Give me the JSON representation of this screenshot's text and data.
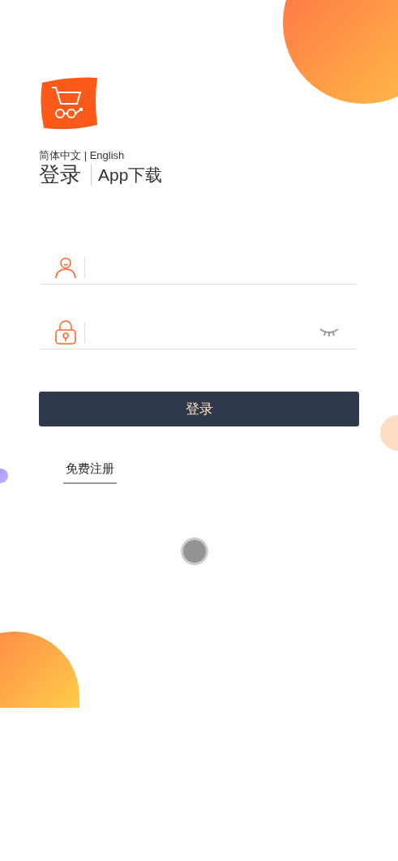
{
  "language_switch": {
    "options": [
      "简体中文",
      "English"
    ],
    "separator": "|"
  },
  "header": {
    "title": "登录",
    "download_link": "App下载"
  },
  "fields": [
    {
      "kind": "username"
    },
    {
      "kind": "password"
    }
  ],
  "login_button": "登录",
  "register_link": "免费注册"
}
